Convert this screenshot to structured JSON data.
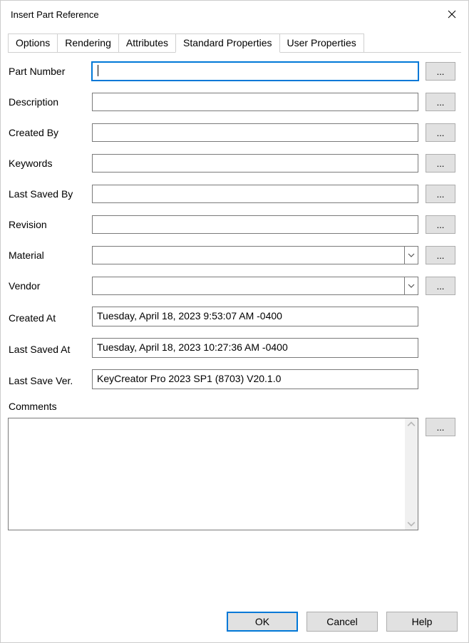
{
  "window": {
    "title": "Insert Part Reference"
  },
  "tabs": {
    "options": "Options",
    "rendering": "Rendering",
    "attributes": "Attributes",
    "standard": "Standard Properties",
    "user": "User Properties"
  },
  "labels": {
    "part_number": "Part Number",
    "description": "Description",
    "created_by": "Created By",
    "keywords": "Keywords",
    "last_saved_by": "Last Saved By",
    "revision": "Revision",
    "material": "Material",
    "vendor": "Vendor",
    "created_at": "Created At",
    "last_saved_at": "Last Saved At",
    "last_save_ver": "Last Save Ver.",
    "comments": "Comments"
  },
  "fields": {
    "part_number": "",
    "description": "",
    "created_by": "",
    "keywords": "",
    "last_saved_by": "",
    "revision": "",
    "material": "",
    "vendor": "",
    "created_at": "Tuesday, April 18, 2023 9:53:07 AM -0400",
    "last_saved_at": "Tuesday, April 18, 2023 10:27:36 AM -0400",
    "last_save_ver": "KeyCreator Pro 2023 SP1 (8703) V20.1.0",
    "comments": ""
  },
  "buttons": {
    "browse": "...",
    "ok": "OK",
    "cancel": "Cancel",
    "help": "Help"
  }
}
